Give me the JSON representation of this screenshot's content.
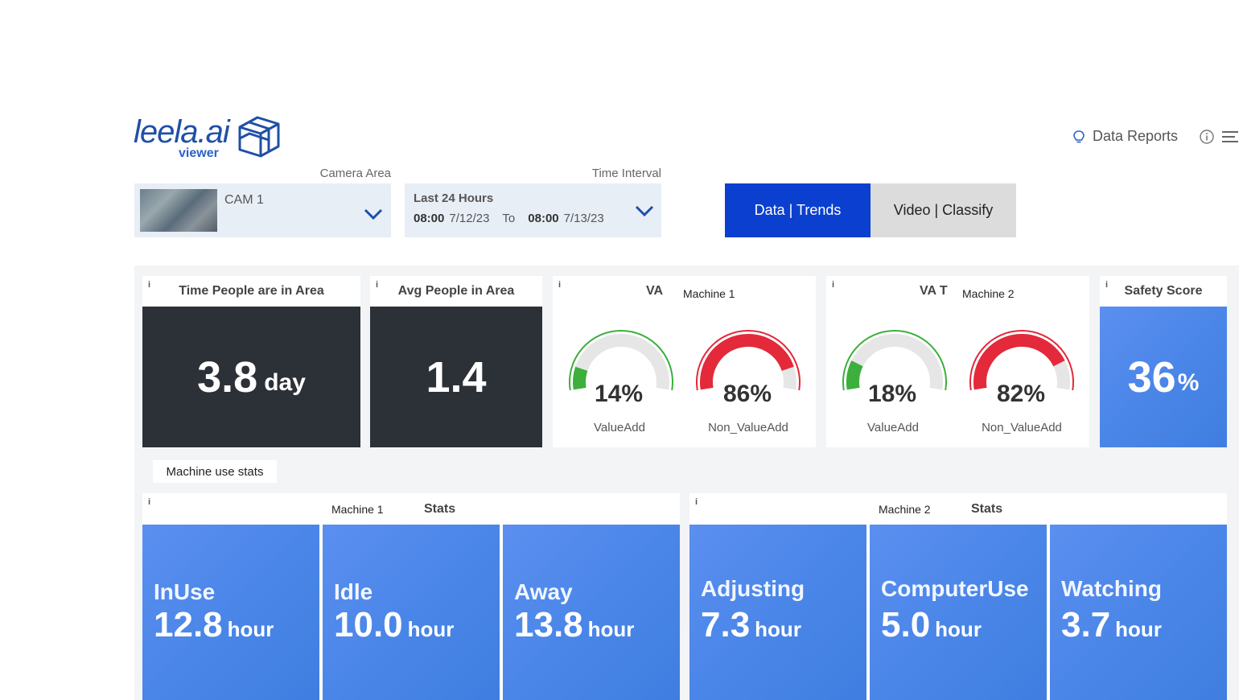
{
  "header": {
    "logo_main": "leela.ai",
    "logo_sub": "viewer",
    "reports_label": "Data Reports"
  },
  "filters": {
    "camera_label": "Camera Area",
    "camera_value": "CAM 1",
    "time_label": "Time Interval",
    "time_range": "Last 24 Hours",
    "from_time": "08:00",
    "from_date": "7/12/23",
    "to_word": "To",
    "to_time": "08:00",
    "to_date": "7/13/23"
  },
  "view_toggle": {
    "data_label": "Data | Trends",
    "video_label": "Video | Classify"
  },
  "cards": {
    "info_mark": "i",
    "time_people": {
      "title": "Time People are in Area",
      "value": "3.8",
      "unit": "day"
    },
    "avg_people": {
      "title": "Avg People in Area",
      "value": "1.4"
    },
    "machine1_va": {
      "prefix": "VA",
      "machine": "Machine 1",
      "value_add": {
        "pct": "14%",
        "label": "ValueAdd",
        "fraction": 0.14,
        "color": "#3caf3c"
      },
      "non_value_add": {
        "pct": "86%",
        "label": "Non_ValueAdd",
        "fraction": 0.86,
        "color": "#e3293a"
      }
    },
    "machine2_va": {
      "prefix": "VA T",
      "machine": "Machine 2",
      "value_add": {
        "pct": "18%",
        "label": "ValueAdd",
        "fraction": 0.18,
        "color": "#3caf3c"
      },
      "non_value_add": {
        "pct": "82%",
        "label": "Non_ValueAdd",
        "fraction": 0.82,
        "color": "#e3293a"
      }
    },
    "safety": {
      "title": "Safety Score",
      "value": "36",
      "unit": "%"
    }
  },
  "machine_stats": {
    "section_label": "Machine use stats",
    "machine1": {
      "machine": "Machine 1",
      "stats_label": "Stats",
      "tiles": [
        {
          "name": "InUse",
          "value": "12.8",
          "unit": "hour"
        },
        {
          "name": "Idle",
          "value": "10.0",
          "unit": "hour"
        },
        {
          "name": "Away",
          "value": "13.8",
          "unit": "hour"
        }
      ]
    },
    "machine2": {
      "machine": "Machine 2",
      "stats_label": "Stats",
      "tiles": [
        {
          "name": "Adjusting",
          "value": "7.3",
          "unit": "hour"
        },
        {
          "name": "ComputerUse",
          "value": "5.0",
          "unit": "hour"
        },
        {
          "name": "Watching",
          "value": "3.7",
          "unit": "hour"
        }
      ]
    }
  },
  "colors": {
    "brand_blue": "#1f4fa8",
    "toggle_active": "#0b3fcf",
    "tile_blue": "#4a86e8",
    "dark_card": "#2c3137",
    "green": "#3caf3c",
    "red": "#e3293a"
  }
}
